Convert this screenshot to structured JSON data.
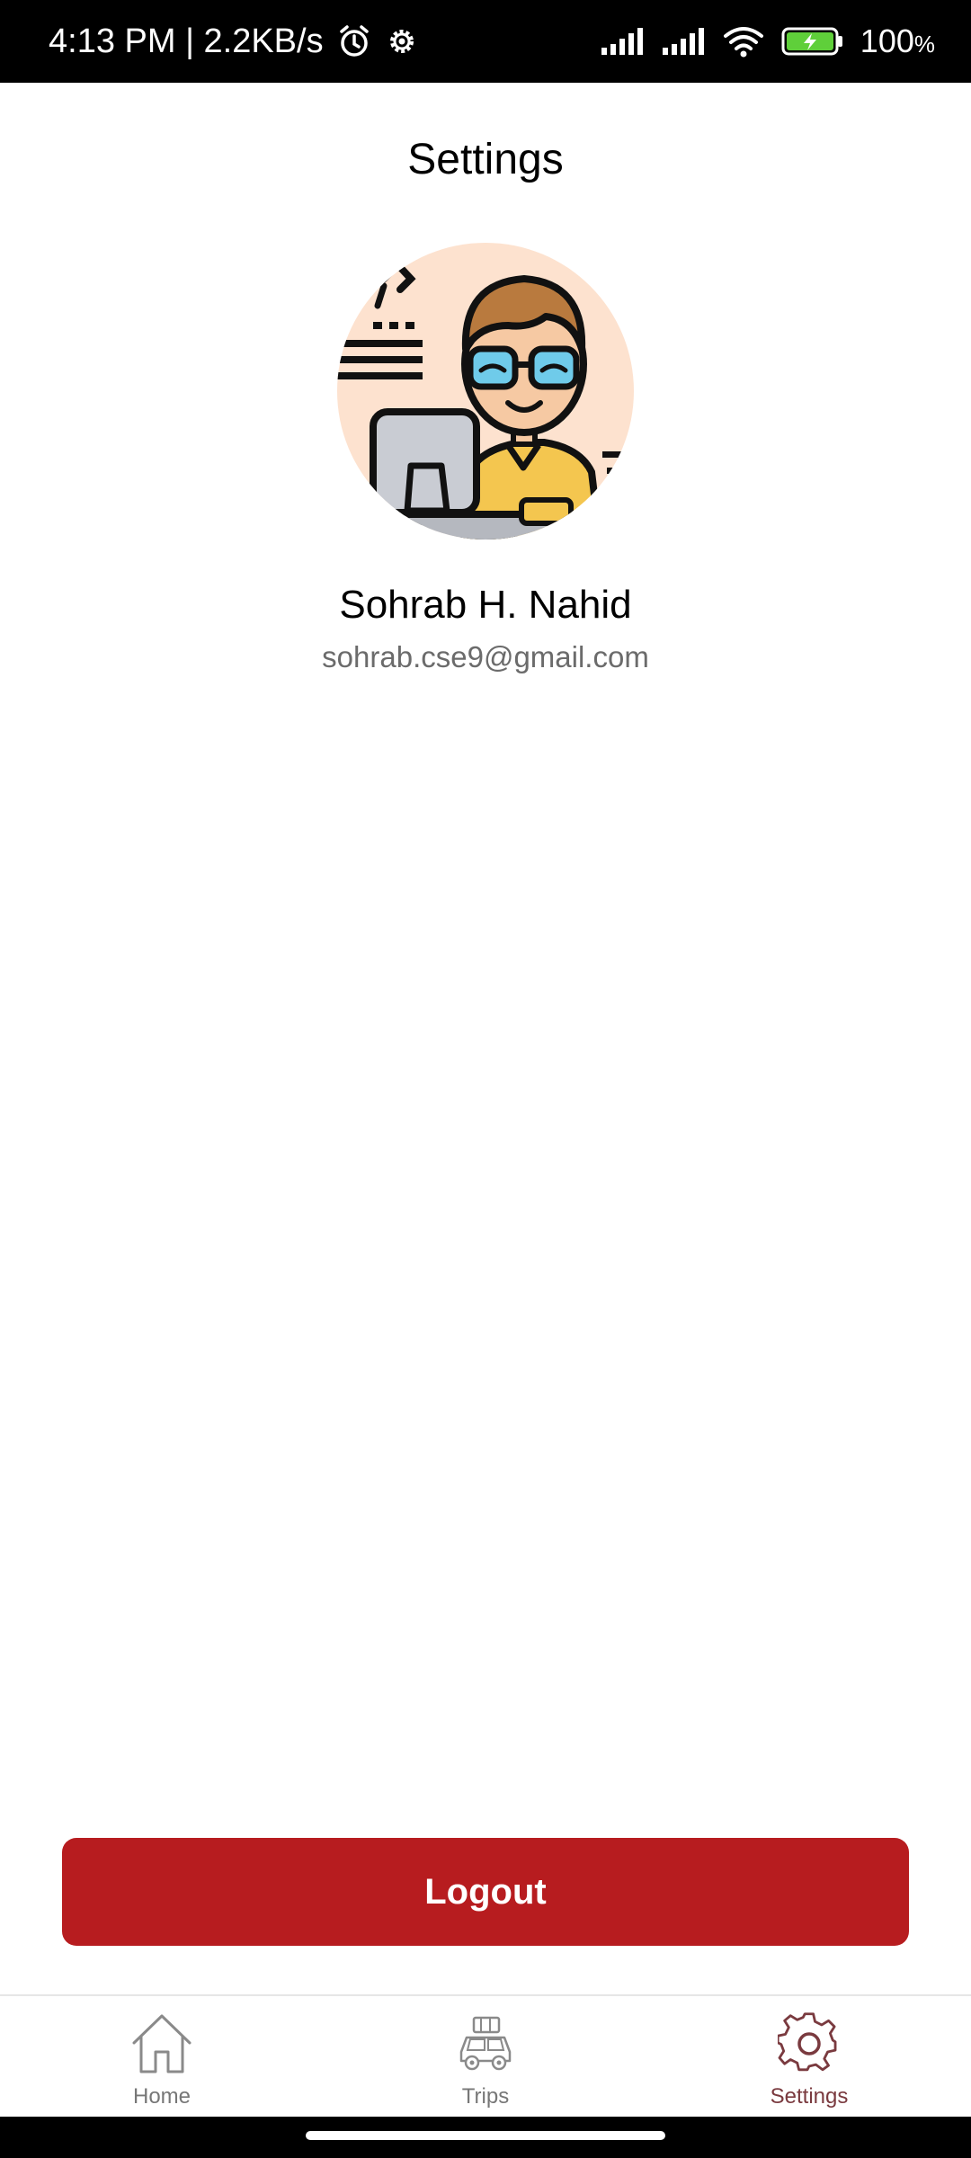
{
  "status_bar": {
    "time_speed": "4:13 PM | 2.2KB/s",
    "battery_percent": "100",
    "battery_unit": "%",
    "icons": [
      "alarm-icon",
      "gear-icon",
      "signal-icon",
      "signal-icon",
      "wifi-icon",
      "battery-charging-icon"
    ]
  },
  "header": {
    "title": "Settings"
  },
  "profile": {
    "name": "Sohrab H. Nahid",
    "email": "sohrab.cse9@gmail.com",
    "avatar_icon": "developer-avatar-illustration"
  },
  "actions": {
    "logout_label": "Logout",
    "logout_color": "#b71c1f"
  },
  "bottom_nav": {
    "items": [
      {
        "label": "Home",
        "icon": "home-icon",
        "active": false
      },
      {
        "label": "Trips",
        "icon": "car-icon",
        "active": false
      },
      {
        "label": "Settings",
        "icon": "gear-icon",
        "active": true
      }
    ],
    "active_color": "#7a3a3f",
    "inactive_color": "#777777"
  }
}
